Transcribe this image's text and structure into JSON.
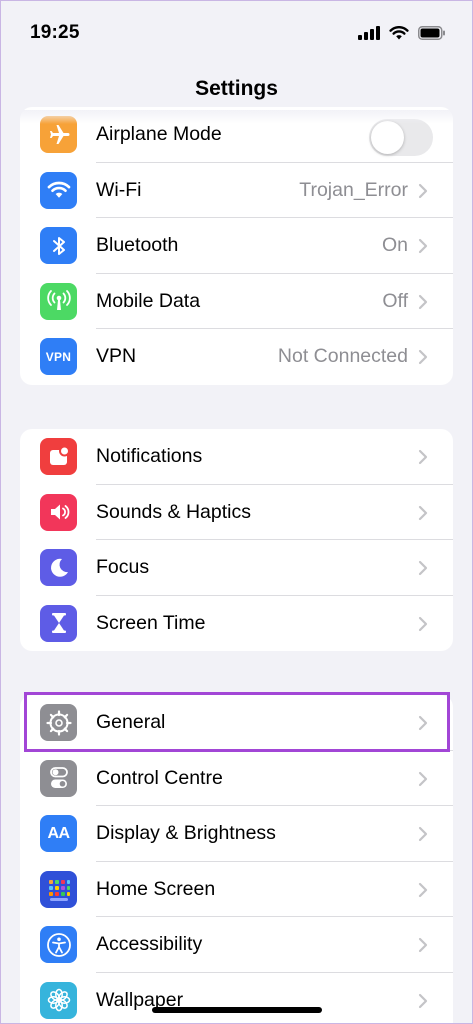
{
  "status_bar": {
    "time": "19:25"
  },
  "nav": {
    "title": "Settings"
  },
  "groups": [
    {
      "rows": [
        {
          "label": "Airplane Mode",
          "value": "",
          "icon": "airplane-icon",
          "color": "#f7a238",
          "toggle": "off"
        },
        {
          "label": "Wi-Fi",
          "value": "Trojan_Error",
          "icon": "wifi-icon",
          "color": "#2f7ef6"
        },
        {
          "label": "Bluetooth",
          "value": "On",
          "icon": "bluetooth-icon",
          "color": "#2f7ef6"
        },
        {
          "label": "Mobile Data",
          "value": "Off",
          "icon": "antenna-icon",
          "color": "#4cd964"
        },
        {
          "label": "VPN",
          "value": "Not Connected",
          "icon": "vpn-icon",
          "icon_text": "VPN",
          "color": "#2f7ef6"
        }
      ]
    },
    {
      "rows": [
        {
          "label": "Notifications",
          "icon": "notifications-icon",
          "color": "#f03e3e"
        },
        {
          "label": "Sounds & Haptics",
          "icon": "speaker-icon",
          "color": "#f2365a"
        },
        {
          "label": "Focus",
          "icon": "moon-icon",
          "color": "#5e5ce6"
        },
        {
          "label": "Screen Time",
          "icon": "hourglass-icon",
          "color": "#5e5ce6"
        }
      ]
    },
    {
      "rows": [
        {
          "label": "General",
          "icon": "gear-icon",
          "color": "#8e8e93"
        },
        {
          "label": "Control Centre",
          "icon": "toggles-icon",
          "color": "#8e8e93"
        },
        {
          "label": "Display & Brightness",
          "icon": "text-size-icon",
          "icon_text": "AA",
          "color": "#2f7ef6"
        },
        {
          "label": "Home Screen",
          "icon": "app-grid-icon",
          "color": "#2f50d8"
        },
        {
          "label": "Accessibility",
          "icon": "accessibility-icon",
          "color": "#2f7ef6"
        },
        {
          "label": "Wallpaper",
          "icon": "flower-icon",
          "color": "#36b4dc"
        }
      ]
    }
  ],
  "highlight": {
    "target": "General",
    "color": "#a246d6"
  }
}
